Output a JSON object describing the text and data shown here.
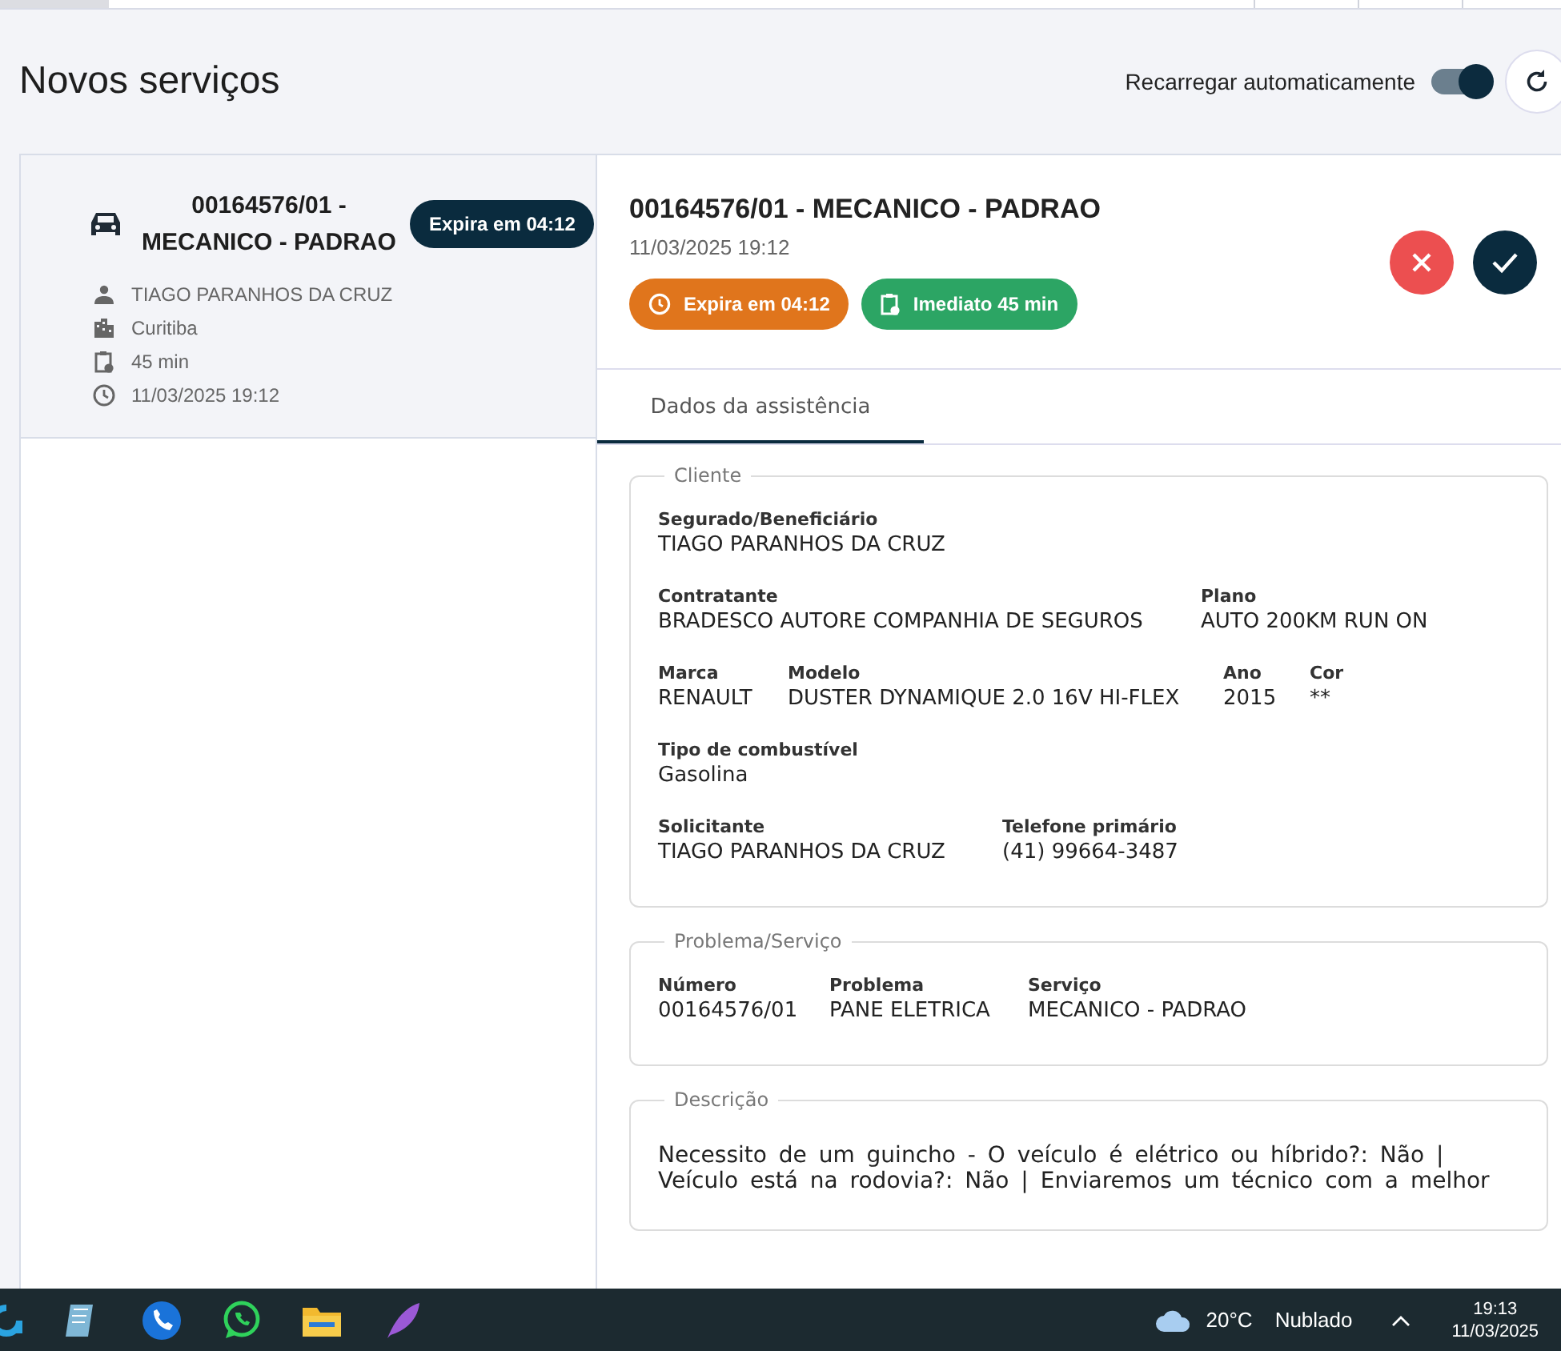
{
  "header": {
    "title": "Novos serviços",
    "auto_reload": {
      "label": "Recarregar automaticamente",
      "on": true
    }
  },
  "service_list": [
    {
      "title": "00164576/01 - MECANICO - PADRAO",
      "badge": "Expira em 04:12",
      "selected": true,
      "details": [
        {
          "kind": "person",
          "text": "TIAGO PARANHOS DA CRUZ"
        },
        {
          "kind": "city",
          "text": "Curitiba"
        },
        {
          "kind": "duration",
          "text": "45 min"
        },
        {
          "kind": "time",
          "text": "11/03/2025 19:12"
        }
      ]
    }
  ],
  "detail": {
    "title": "00164576/01 - MECANICO - PADRAO",
    "datetime": "11/03/2025 19:12",
    "badges": [
      {
        "kind": "expiry",
        "text": "Expira em 04:12"
      },
      {
        "kind": "priority",
        "text": "Imediato 45 min"
      }
    ],
    "tabs": [
      {
        "label": "Dados da assistência",
        "selected": true
      }
    ],
    "sections": [
      {
        "title": "Cliente",
        "groups": [
          {
            "fields": [
              {
                "label": "Segurado/Beneficiário",
                "value": "TIAGO PARANHOS DA CRUZ"
              }
            ]
          },
          {
            "fields": [
              {
                "label": "Contratante",
                "value": "BRADESCO AUTORE COMPANHIA DE SEGUROS"
              },
              {
                "label": "Plano",
                "value": "AUTO 200KM RUN ON"
              }
            ]
          },
          {
            "fields": [
              {
                "label": "Marca",
                "value": "RENAULT"
              },
              {
                "label": "Modelo",
                "value": "DUSTER DYNAMIQUE 2.0 16V HI-FLEX"
              },
              {
                "label": "Ano",
                "value": "2015"
              },
              {
                "label": "Cor",
                "value": "**"
              }
            ]
          },
          {
            "fields": [
              {
                "label": "Tipo de combustível",
                "value": "Gasolina"
              }
            ]
          },
          {
            "fields": [
              {
                "label": "Solicitante",
                "value": "TIAGO PARANHOS DA CRUZ"
              },
              {
                "label": "Telefone primário",
                "value": "(41) 99664-3487"
              }
            ]
          }
        ]
      },
      {
        "title": "Problema/Serviço",
        "groups": [
          {
            "fields": [
              {
                "label": "Número",
                "value": "00164576/01"
              },
              {
                "label": "Problema",
                "value": "PANE ELETRICA"
              },
              {
                "label": "Serviço",
                "value": "MECANICO - PADRAO"
              }
            ]
          }
        ]
      },
      {
        "title": "Descrição",
        "text": "Necessito de um guincho - O veículo é elétrico ou híbrido?: Não | Veículo está na rodovia?: Não | Enviaremos um técnico com a melhor"
      }
    ]
  },
  "taskbar": {
    "weather": {
      "temperature": "20°C",
      "condition": "Nublado"
    },
    "time": "19:13",
    "date": "11/03/2025"
  }
}
